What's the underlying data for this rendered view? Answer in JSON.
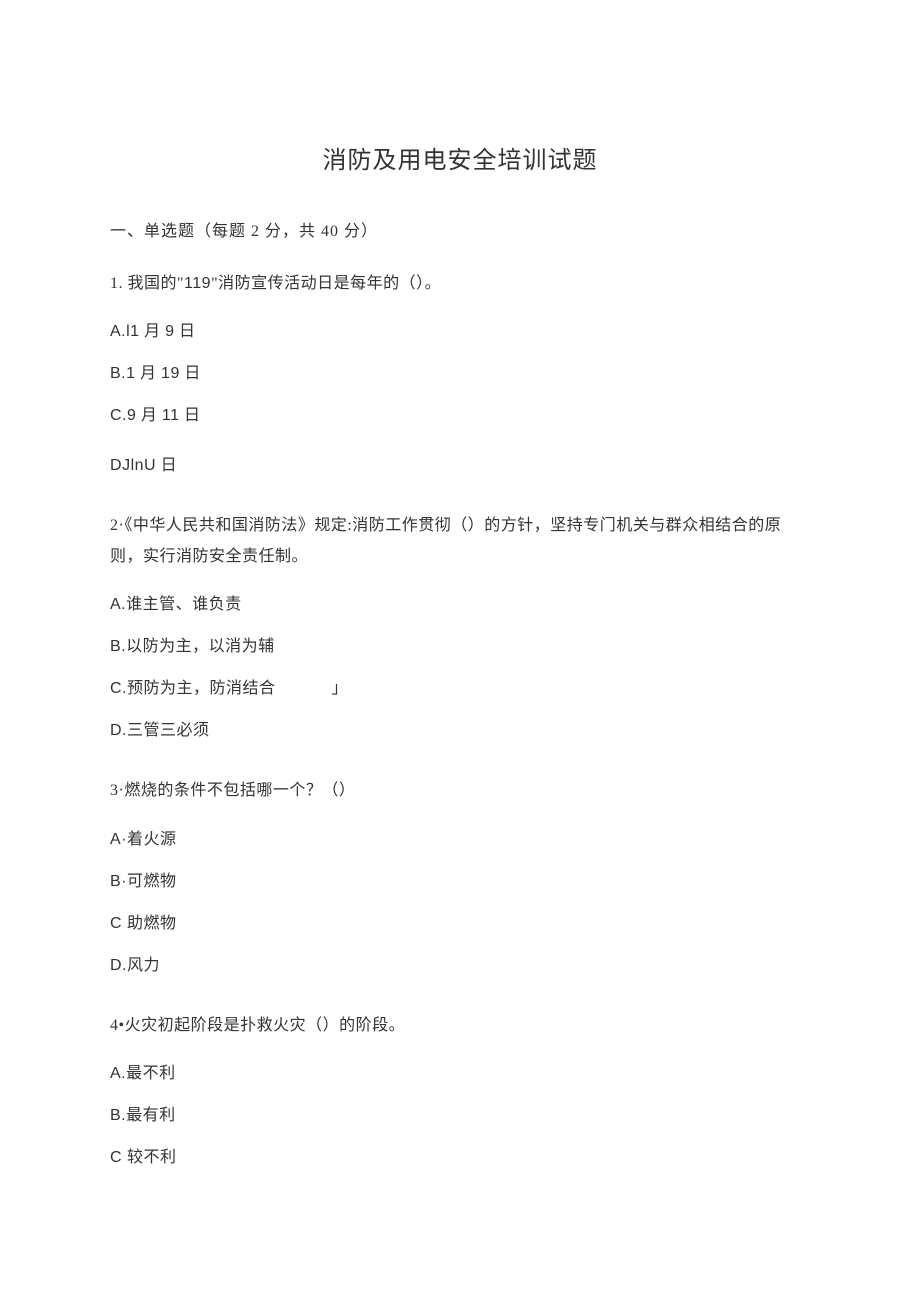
{
  "title": "消防及用电安全培训试题",
  "section_header": "一、单选题（每题 2 分，共 40 分）",
  "questions": [
    {
      "stem_prefix": "1. 我国的",
      "stem_quote_open": "\"",
      "stem_119": "119",
      "stem_quote_close": "\"",
      "stem_suffix": "消防宣传活动日是每年的（）。",
      "options": [
        {
          "letter": "A.",
          "mid": "l1",
          "cn1": " 月 ",
          "mid2": "9",
          "cn2": " 日"
        },
        {
          "letter": "B.",
          "mid": "1",
          "cn1": " 月 ",
          "mid2": "19",
          "cn2": " 日"
        },
        {
          "letter": "C.",
          "mid": "9",
          "cn1": " 月 ",
          "mid2": "11",
          "cn2": " 日"
        },
        {
          "letter": "D",
          "mid": "JlnU",
          "cn1": " 日",
          "mid2": "",
          "cn2": ""
        }
      ]
    },
    {
      "stem_prefix": "2·《中华人民共和国消防法》规定:消防工作贯彻（）的方针，坚持专门机关与群众相结合的原则，实行消防安全责任制。",
      "options": [
        {
          "letter": "A.",
          "text": "谁主管、谁负责"
        },
        {
          "letter": "B.",
          "text": "以防为主，以消为辅"
        },
        {
          "letter": "C.",
          "text": "预防为主，防消结合",
          "mark": "」"
        },
        {
          "letter": "D.",
          "text": "三管三必须"
        }
      ]
    },
    {
      "stem_prefix": "3·燃烧的条件不包括哪一个？（）",
      "options": [
        {
          "letter": "A·",
          "text": "着火源"
        },
        {
          "letter": "B·",
          "text": "可燃物"
        },
        {
          "letter": "C ",
          "text": "助燃物"
        },
        {
          "letter": "D.",
          "text": "风力"
        }
      ]
    },
    {
      "stem_prefix": "4•火灾初起阶段是扑救火灾（）的阶段。",
      "options": [
        {
          "letter": "A.",
          "text": "最不利"
        },
        {
          "letter": "B.",
          "text": "最有利"
        },
        {
          "letter": "C ",
          "text": "较不利"
        }
      ]
    }
  ]
}
